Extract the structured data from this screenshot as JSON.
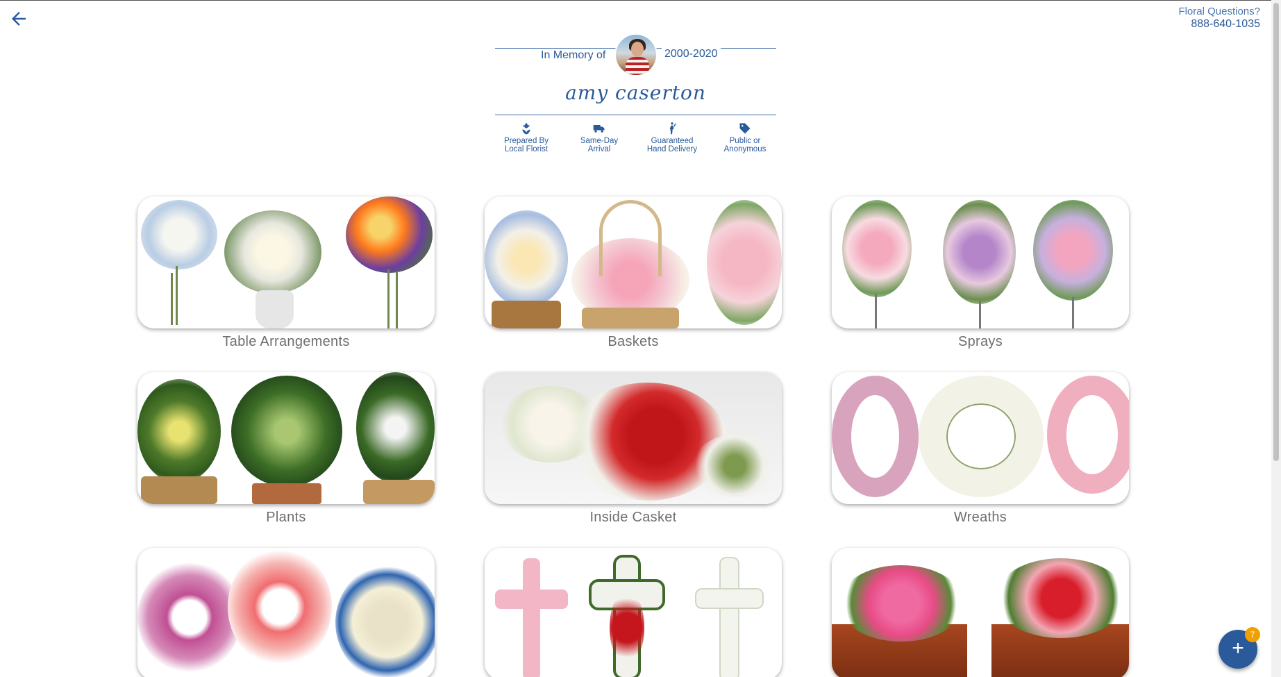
{
  "header": {
    "questions_label": "Floral Questions?",
    "questions_phone": "888-640-1035"
  },
  "memorial": {
    "in_memory_label": "In Memory of",
    "years": "2000-2020",
    "name": "amy caserton"
  },
  "features": [
    {
      "icon": "florist-icon",
      "line1": "Prepared By",
      "line2": "Local Florist"
    },
    {
      "icon": "truck-icon",
      "line1": "Same-Day",
      "line2": "Arrival"
    },
    {
      "icon": "delivery-person-icon",
      "line1": "Guaranteed",
      "line2": "Hand Delivery"
    },
    {
      "icon": "tag-icon",
      "line1": "Public or",
      "line2": "Anonymous"
    }
  ],
  "categories": [
    {
      "label": "Table Arrangements"
    },
    {
      "label": "Baskets"
    },
    {
      "label": "Sprays"
    },
    {
      "label": "Plants"
    },
    {
      "label": "Inside Casket"
    },
    {
      "label": "Wreaths"
    },
    {
      "label": ""
    },
    {
      "label": ""
    },
    {
      "label": ""
    }
  ],
  "cart": {
    "badge_count": "7",
    "button_symbol": "+"
  },
  "colors": {
    "brand_blue": "#2a5a9a",
    "badge_orange": "#f0a000",
    "label_gray": "#6e6e6e"
  }
}
